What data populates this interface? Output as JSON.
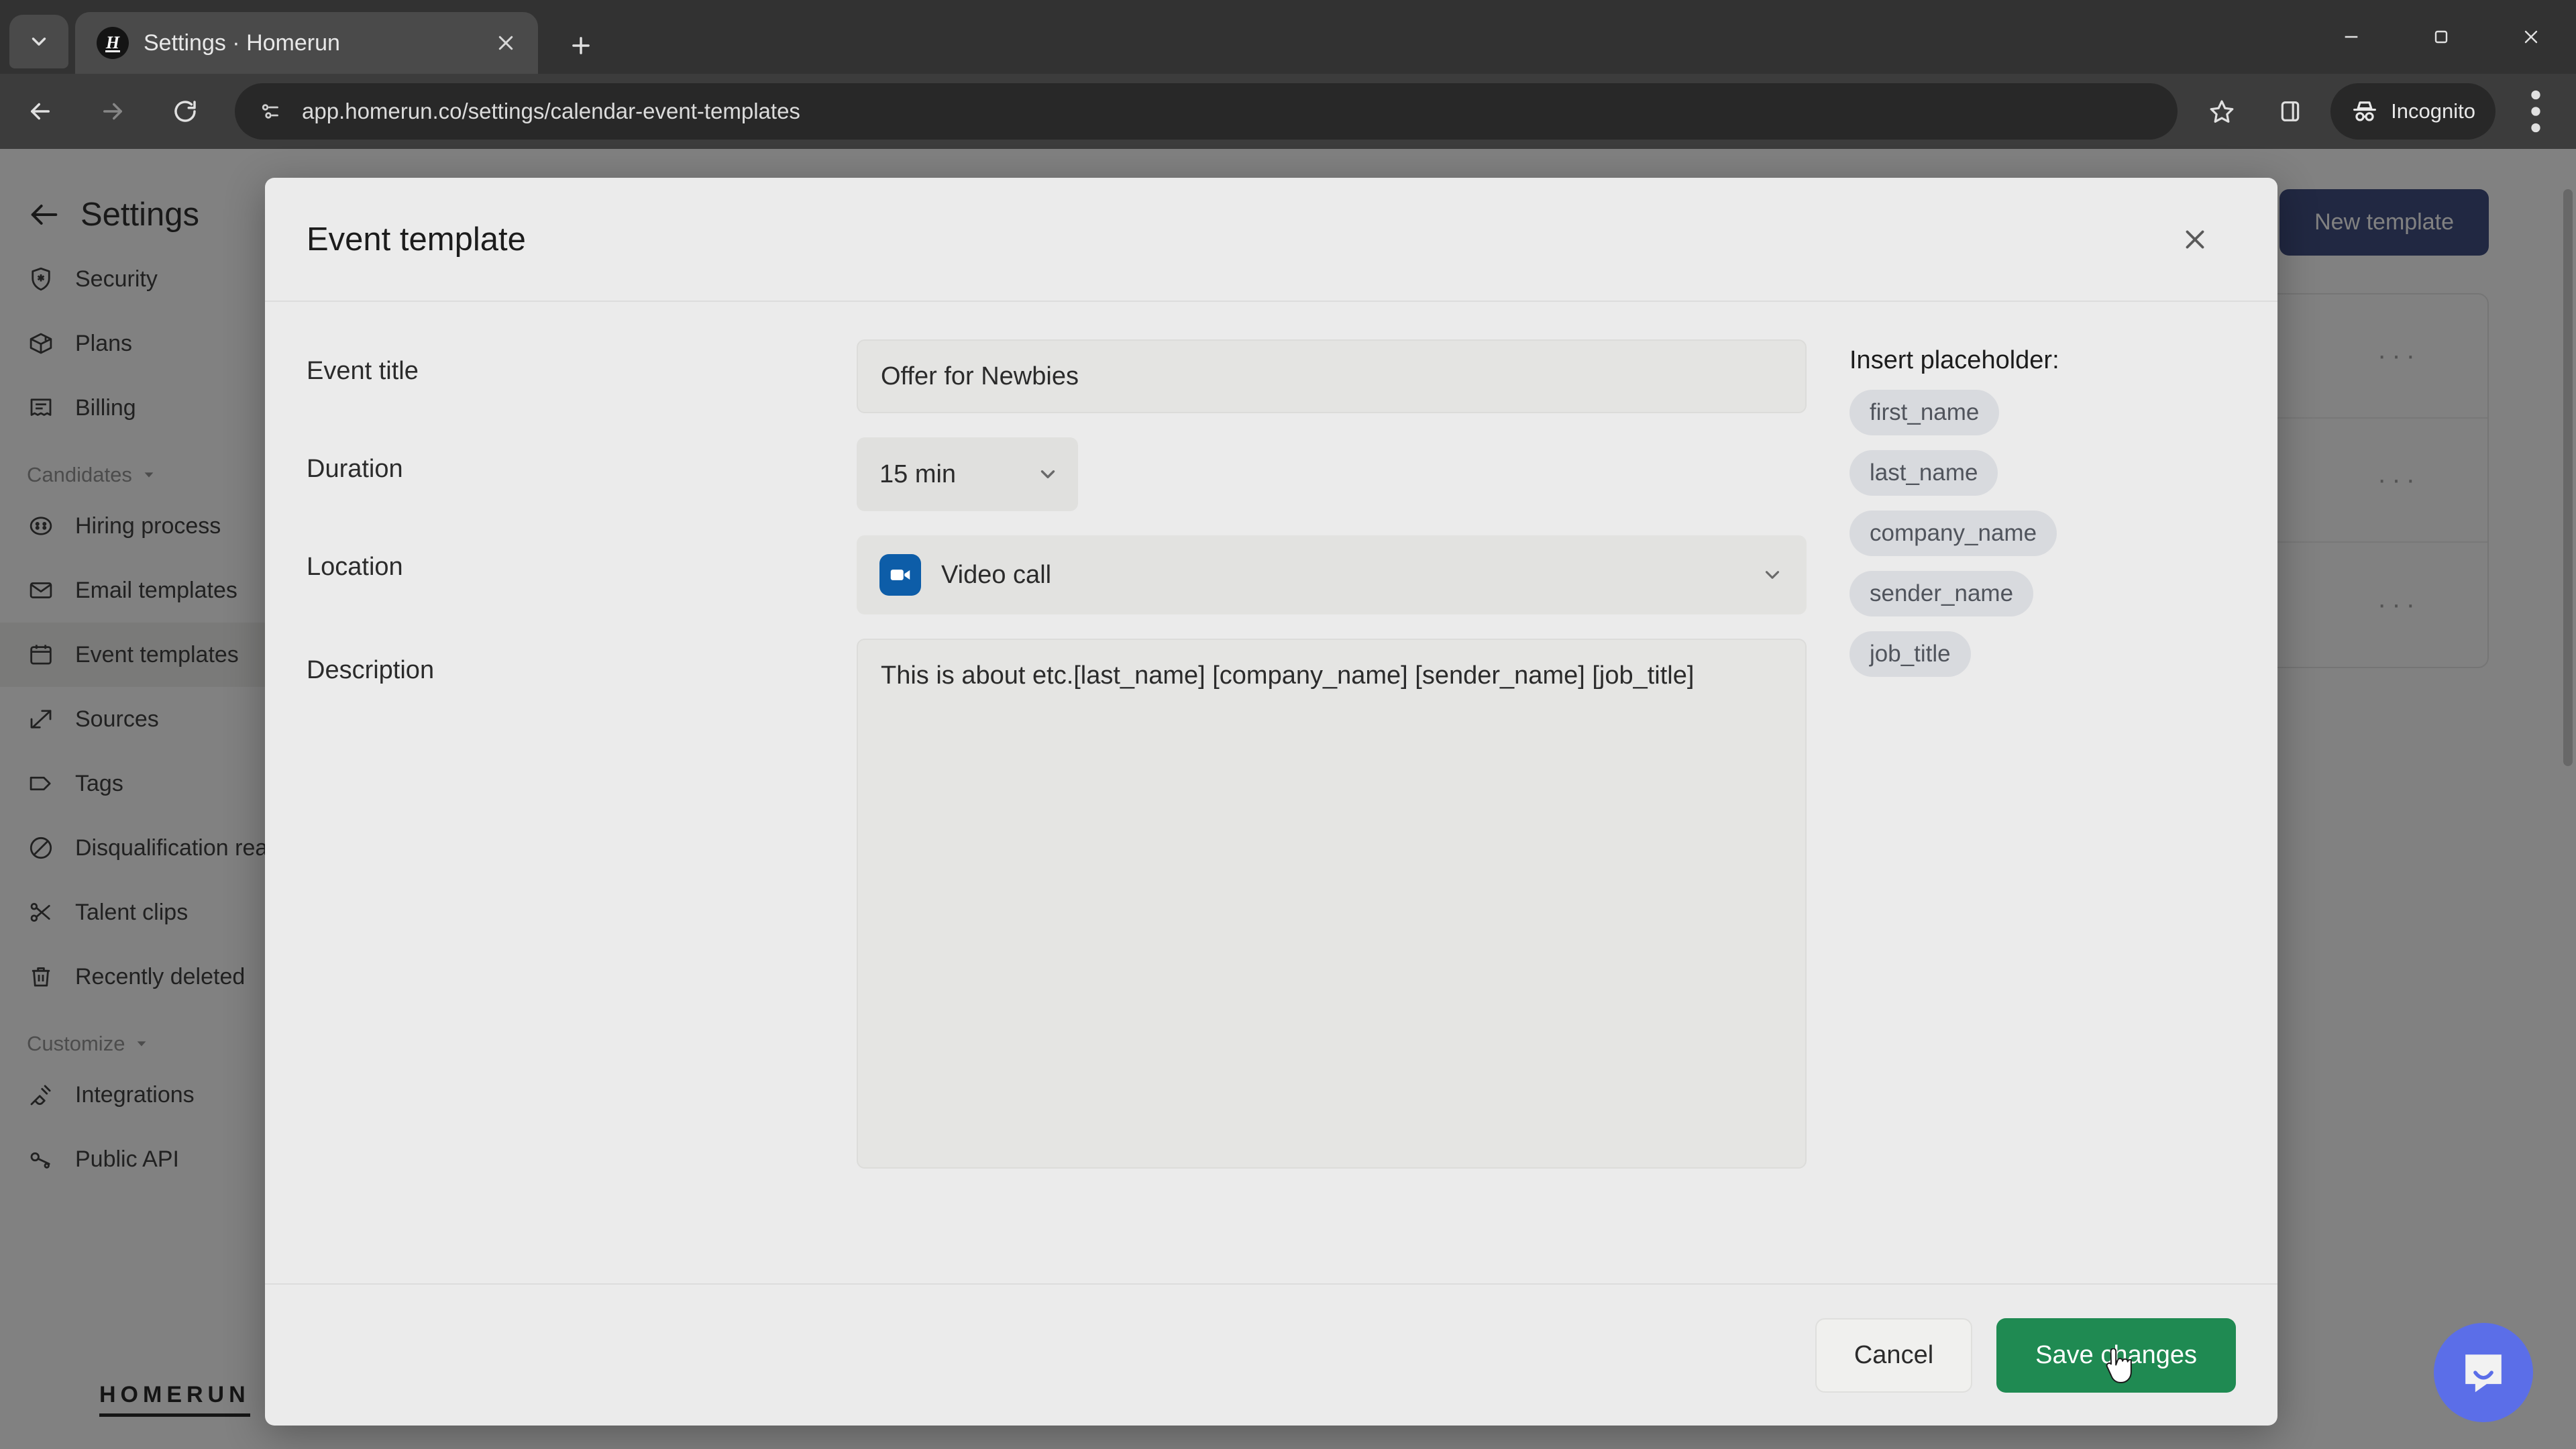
{
  "browser": {
    "tab": {
      "title": "Settings · Homerun",
      "favicon_letter": "H"
    },
    "url": "app.homerun.co/settings/calendar-event-templates",
    "profile_label": "Incognito",
    "icons": {
      "tab_list": "chevron-down-icon",
      "new_tab": "plus-icon",
      "tab_close": "close-icon",
      "back": "back-arrow-icon",
      "forward": "forward-arrow-icon",
      "reload": "reload-icon",
      "site_info": "page-info-icon",
      "bookmark": "star-icon",
      "side_panel": "side-panel-icon",
      "incognito": "incognito-hat-icon",
      "menu": "three-dots-vertical-icon",
      "minimize": "minimize-icon",
      "maximize": "maximize-icon",
      "window_close": "window-close-icon"
    }
  },
  "sidebar": {
    "back_icon": "back-arrow-icon",
    "title": "Settings",
    "logo": "HOMERUN",
    "groups": [
      {
        "label": null,
        "items": [
          {
            "label": "Security",
            "icon": "shield-star-icon",
            "active": false
          },
          {
            "label": "Plans",
            "icon": "box-icon",
            "active": false
          },
          {
            "label": "Billing",
            "icon": "receipt-icon",
            "active": false
          }
        ]
      },
      {
        "label": "Candidates",
        "caret_icon": "caret-down-icon",
        "items": [
          {
            "label": "Hiring process",
            "icon": "face-icon",
            "active": false
          },
          {
            "label": "Email templates",
            "icon": "envelope-icon",
            "active": false
          },
          {
            "label": "Event templates",
            "icon": "calendar-icon",
            "active": true
          },
          {
            "label": "Sources",
            "icon": "arrow-out-box-icon",
            "active": false
          },
          {
            "label": "Tags",
            "icon": "tag-icon",
            "active": false
          },
          {
            "label": "Disqualification reasons",
            "icon": "no-entry-icon",
            "active": false
          },
          {
            "label": "Talent clips",
            "icon": "scissors-icon",
            "active": false
          },
          {
            "label": "Recently deleted",
            "icon": "trash-icon",
            "active": false
          }
        ]
      },
      {
        "label": "Customize",
        "caret_icon": "caret-down-icon",
        "items": [
          {
            "label": "Integrations",
            "icon": "plug-icon",
            "active": false
          },
          {
            "label": "Public API",
            "icon": "api-key-icon",
            "active": false
          }
        ]
      }
    ]
  },
  "content": {
    "new_template_button": "New template",
    "row_menu_label": "···",
    "rows": 3
  },
  "modal": {
    "title": "Event template",
    "close_icon": "close-icon",
    "fields": {
      "event_title": {
        "label": "Event title",
        "value": "Offer for Newbies"
      },
      "duration": {
        "label": "Duration",
        "value": "15 min",
        "caret_icon": "chevron-down-icon"
      },
      "location": {
        "label": "Location",
        "value": "Video call",
        "icon": "video-call-icon",
        "caret_icon": "chevron-down-icon"
      },
      "description": {
        "label": "Description",
        "value": "This is about etc.[last_name] [company_name] [sender_name] [job_title]"
      }
    },
    "placeholders": {
      "title": "Insert placeholder:",
      "chips": [
        "first_name",
        "last_name",
        "company_name",
        "sender_name",
        "job_title"
      ]
    },
    "footer": {
      "cancel_label": "Cancel",
      "save_label": "Save changes"
    }
  },
  "widgets": {
    "intercom_icon": "chat-bubble-icon"
  },
  "colors": {
    "save_button": "#1f8a52",
    "new_template_button": "#2c3b74",
    "video_icon": "#0d5da8",
    "intercom": "#5b6ee8",
    "modal_bg": "#ebebeb"
  }
}
